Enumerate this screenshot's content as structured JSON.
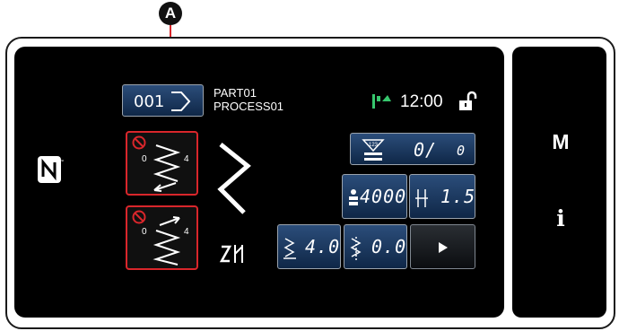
{
  "callout": {
    "marker": "A"
  },
  "header": {
    "pattern_number": "001",
    "part_name": "PART01",
    "process_name": "PROCESS01",
    "time": "12:00"
  },
  "counter": {
    "current": "0/",
    "target": "0"
  },
  "speed": {
    "value": "4000"
  },
  "pitch": {
    "value": "1.5"
  },
  "feed_left": {
    "value": "4.0"
  },
  "feed_right": {
    "value": "0.0"
  },
  "side_panel": {
    "mode_label": "M",
    "info_label": "i"
  },
  "tension_tiles": [
    {
      "low": "0",
      "high": "4"
    },
    {
      "low": "0",
      "high": "4"
    }
  ],
  "colors": {
    "accent_red": "#d9262b",
    "button_blue": "#1c3a63",
    "status_green": "#37c76e"
  }
}
